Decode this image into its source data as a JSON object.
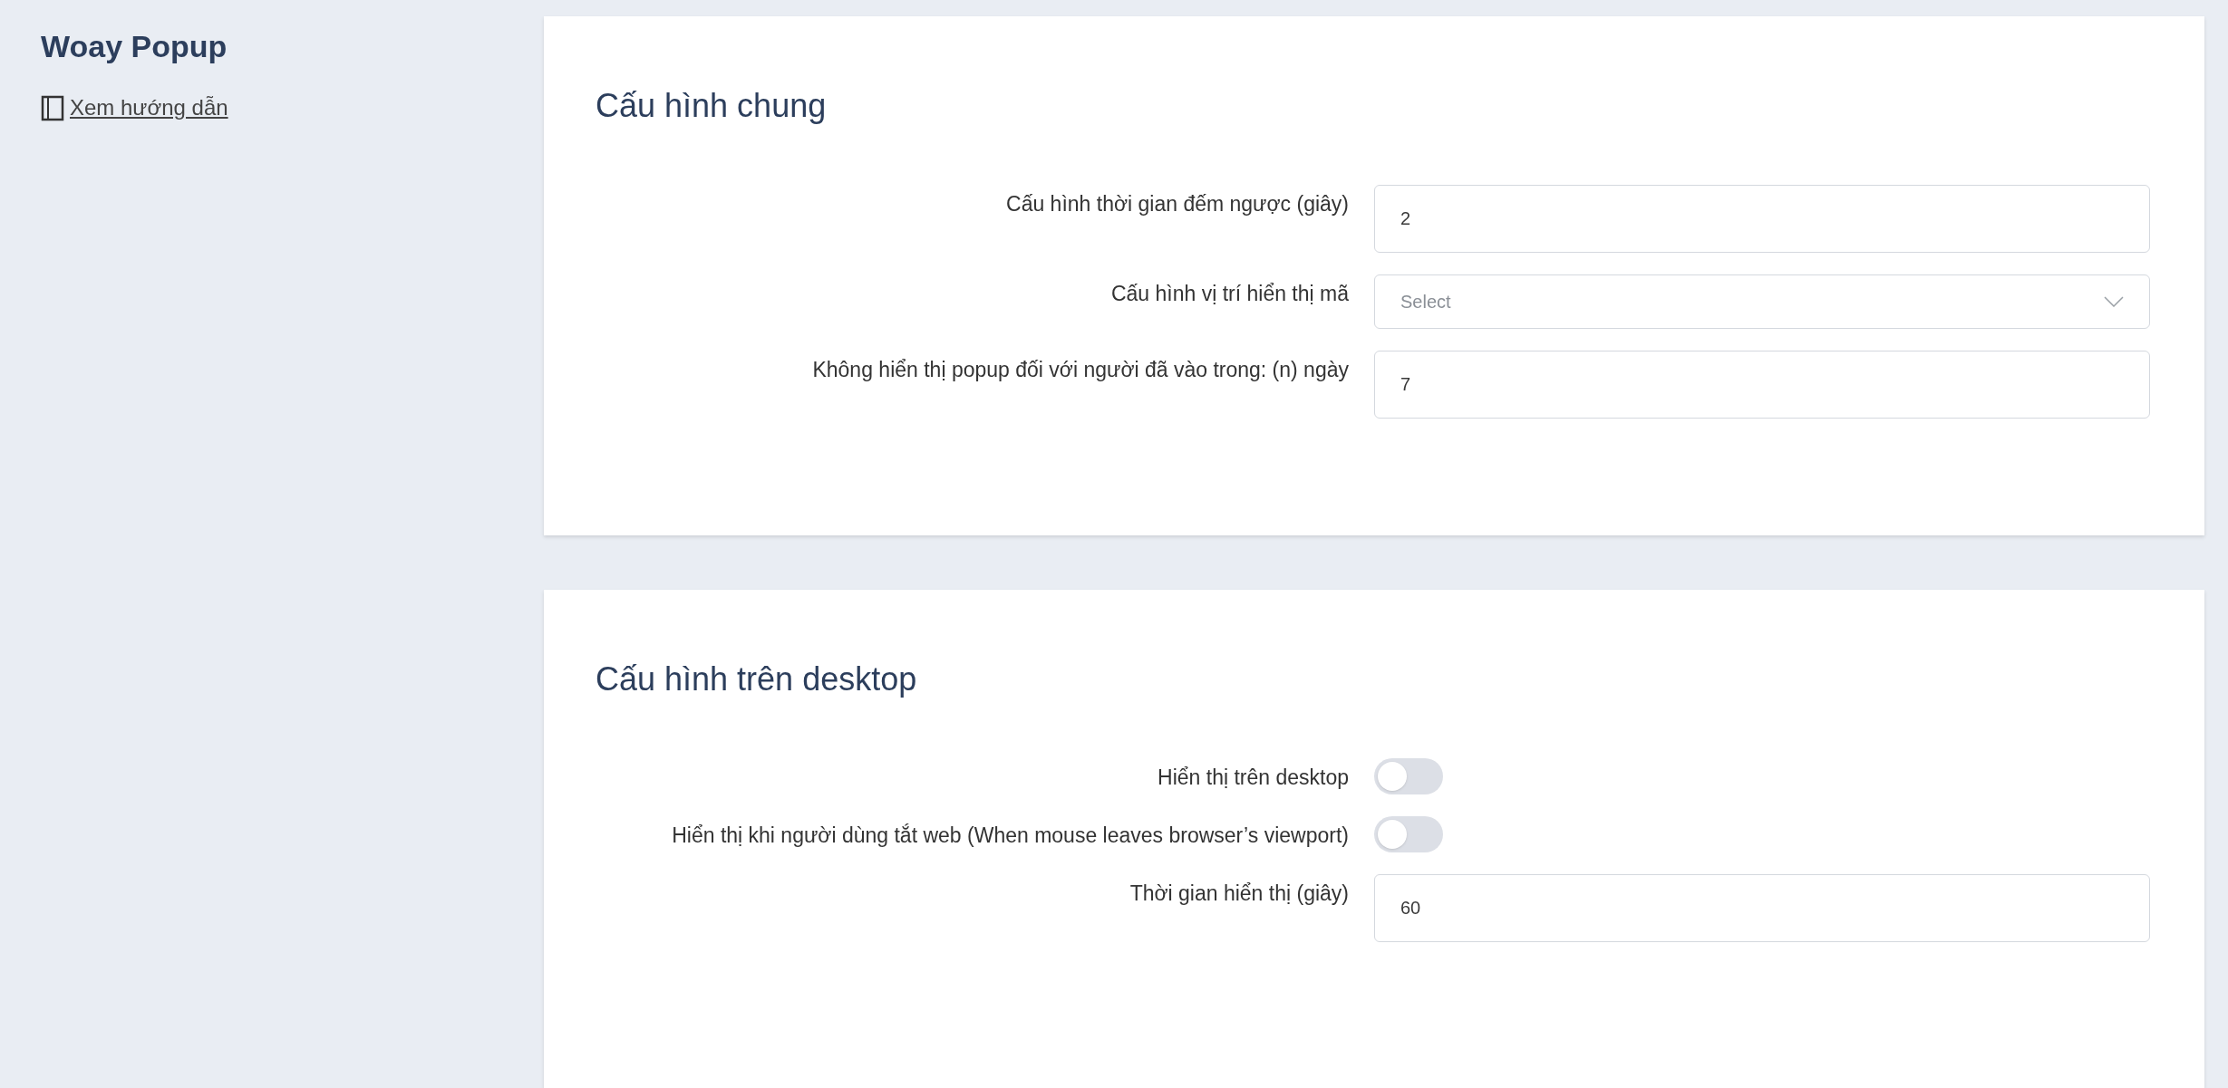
{
  "sidebar": {
    "title": "Woay Popup",
    "guide_link": "Xem hướng dẫn"
  },
  "sections": [
    {
      "title": "Cấu hình chung",
      "fields": [
        {
          "kind": "input",
          "label": "Cấu hình thời gian đếm ngược (giây)",
          "value": "2"
        },
        {
          "kind": "select",
          "label": "Cấu hình vị trí hiển thị mã",
          "placeholder": "Select"
        },
        {
          "kind": "input",
          "label": "Không hiển thị popup đối với người đã vào trong: (n) ngày",
          "value": "7"
        }
      ]
    },
    {
      "title": "Cấu hình trên desktop",
      "fields": [
        {
          "kind": "toggle",
          "label": "Hiển thị trên desktop",
          "on": false
        },
        {
          "kind": "toggle",
          "label": "Hiển thị khi người dùng tắt web (When mouse leaves browser’s viewport)",
          "on": false
        },
        {
          "kind": "input",
          "label": "Thời gian hiển thị (giây)",
          "value": "60"
        }
      ]
    }
  ]
}
